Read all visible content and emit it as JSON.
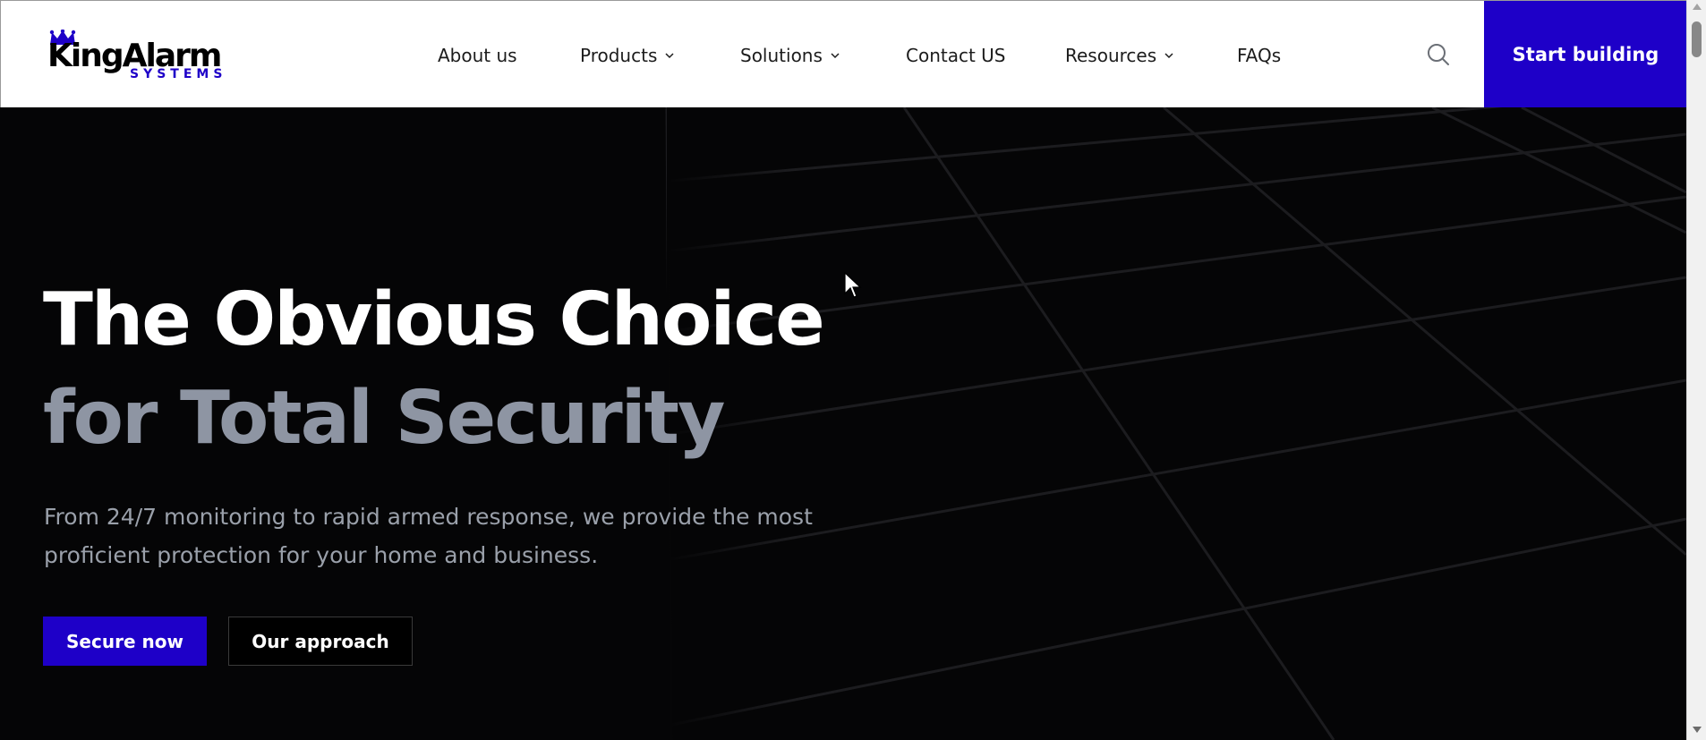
{
  "brand": {
    "name_main": "KingAlarm",
    "name_sub": "SYSTEMS",
    "accent_color": "#1e00c8",
    "crown_icon": "crown-icon"
  },
  "nav": {
    "items": [
      {
        "label": "About us",
        "has_dropdown": false
      },
      {
        "label": "Products",
        "has_dropdown": true
      },
      {
        "label": "Solutions",
        "has_dropdown": true
      },
      {
        "label": "Contact US",
        "has_dropdown": false
      },
      {
        "label": "Resources",
        "has_dropdown": true
      },
      {
        "label": "FAQs",
        "has_dropdown": false
      }
    ],
    "search_icon": "search-icon",
    "cta_label": "Start building"
  },
  "hero": {
    "headline_line1": "The Obvious Choice",
    "headline_line2": "for Total Security",
    "subtext": "From 24/7 monitoring to rapid armed response, we provide the most proficient protection for your home and business.",
    "primary_button": "Secure now",
    "secondary_button": "Our approach",
    "headline_color": "#ffffff",
    "headline_secondary_color": "#8e95a3"
  }
}
